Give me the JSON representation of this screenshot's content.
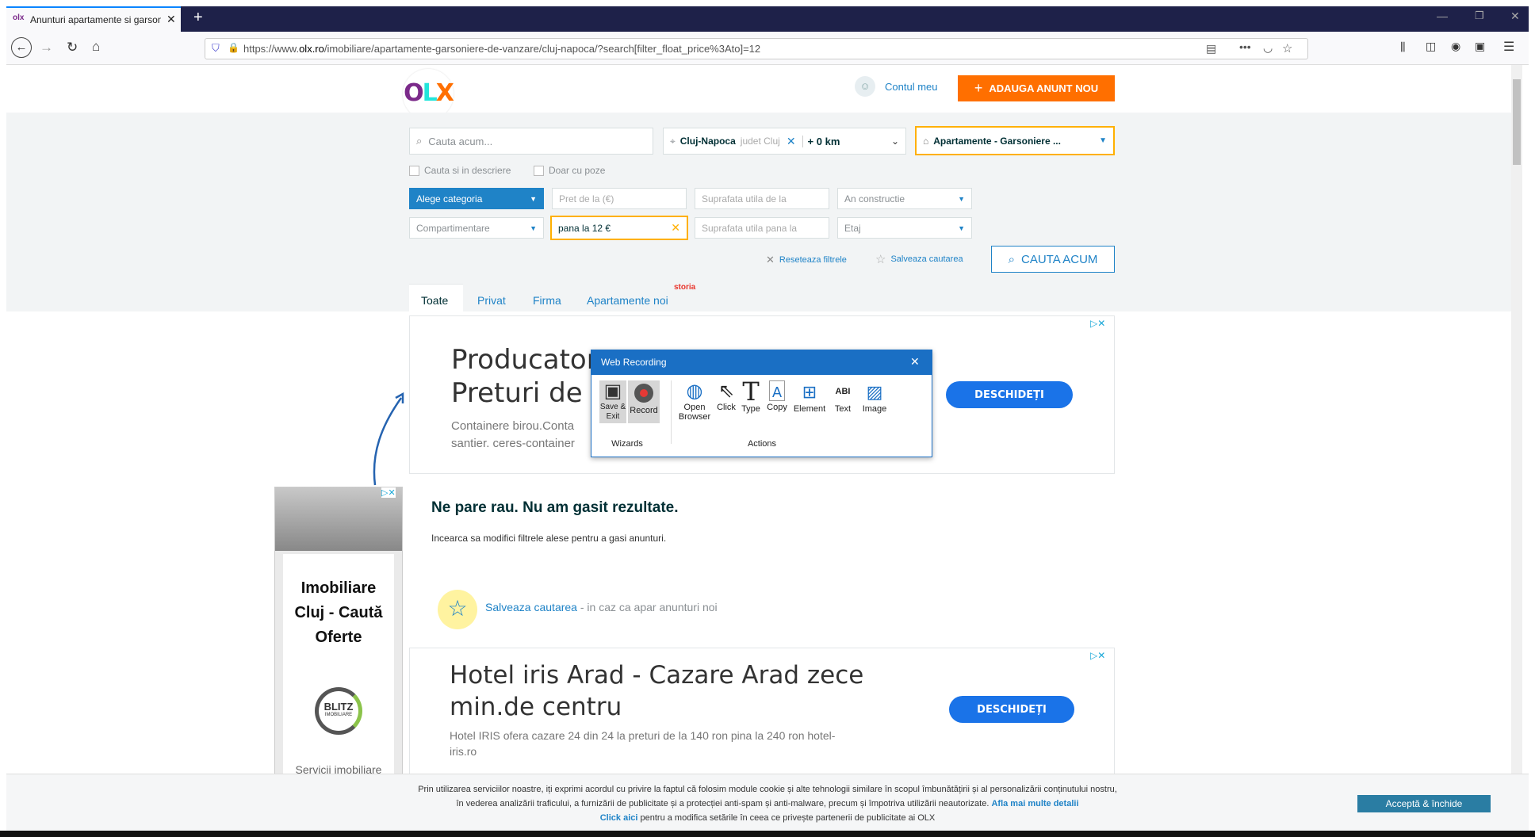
{
  "browser": {
    "tab_title": "Anunturi apartamente si garsoniere",
    "url_prefix": "https://www.",
    "url_domain": "olx.ro",
    "url_rest": "/imobiliare/apartamente-garsoniere-de-vanzare/cluj-napoca/?search[filter_float_price%3Ato]=12"
  },
  "header": {
    "logo": "OLX",
    "account_label": "Contul meu",
    "post_ad_label": "ADAUGA ANUNT NOU",
    "brand_orange": "#ff6f00",
    "accent_blue": "#1f83c7"
  },
  "search": {
    "query_placeholder": "Cauta acum...",
    "location_city": "Cluj-Napoca",
    "location_county": "judet Cluj",
    "radius": "+ 0 km",
    "category": "Apartamente - Garsoniere ...",
    "check_description": "Cauta si in descriere",
    "check_photos": "Doar cu poze",
    "subcategory": "Alege categoria",
    "price_from_placeholder": "Pret de la (€)",
    "price_to_value": "pana la 12 €",
    "area_from_placeholder": "Suprafata utila de la",
    "area_to_placeholder": "Suprafata utila pana la",
    "year_built": "An constructie",
    "partitioning": "Compartimentare",
    "floor": "Etaj",
    "reset_label": "Reseteaza filtrele",
    "save_search_label": "Salveaza cautarea",
    "search_button": "CAUTA ACUM"
  },
  "tabs": [
    "Toate",
    "Privat",
    "Firma",
    "Apartamente noi"
  ],
  "storia_badge": "storia",
  "ad1": {
    "title_line1": "Producator",
    "title_line2": "Preturi de p",
    "body_line1": "Containere birou.Conta",
    "body_line2": "santier. ceres-container",
    "cta": "DESCHIDEȚI"
  },
  "results": {
    "empty_title": "Ne pare rau. Nu am gasit rezultate.",
    "empty_hint": "Incearca sa modifici filtrele alese pentru a gasi anunturi.",
    "save_link": "Salveaza cautarea",
    "save_suffix": " - in caz ca apar anunturi noi"
  },
  "ad2": {
    "title_line1": "Hotel iris Arad - Cazare Arad zece",
    "title_line2": "min.de centru",
    "body_line1": "Hotel IRIS ofera cazare 24 din 24 la preturi de la 140 ron pina la 240 ron hotel-",
    "body_line2": "iris.ro",
    "cta": "DESCHIDEȚI"
  },
  "side_ad": {
    "title": "Imobiliare Cluj - Caută Oferte",
    "logo_text": "BLITZ",
    "logo_sub": "IMOBILIARE",
    "footer": "Servicii imobiliare"
  },
  "dialog": {
    "title": "Web Recording",
    "save_exit": "Save & Exit",
    "record": "Record",
    "group_wizards": "Wizards",
    "open_browser": "Open Browser",
    "click": "Click",
    "type": "Type",
    "copy": "Copy",
    "element": "Element",
    "text": "Text",
    "image": "Image",
    "group_actions": "Actions"
  },
  "cookie": {
    "line1": "Prin utilizarea serviciilor noastre, iți exprimi acordul cu privire la faptul că folosim module cookie și alte tehnologii similare în scopul îmbunătățirii și al personalizării conținutului nostru,",
    "line2": "în vederea analizării traficului, a furnizării de publicitate și a protecției anti-spam și anti-malware, precum și împotriva utilizării neautorizate.",
    "more_link": "Afla mai multe detalii",
    "click_here": "Click aici",
    "line3": " pentru a modifica setările în ceea ce privește partenerii de publicitate ai OLX",
    "accept": "Acceptă & închide"
  }
}
